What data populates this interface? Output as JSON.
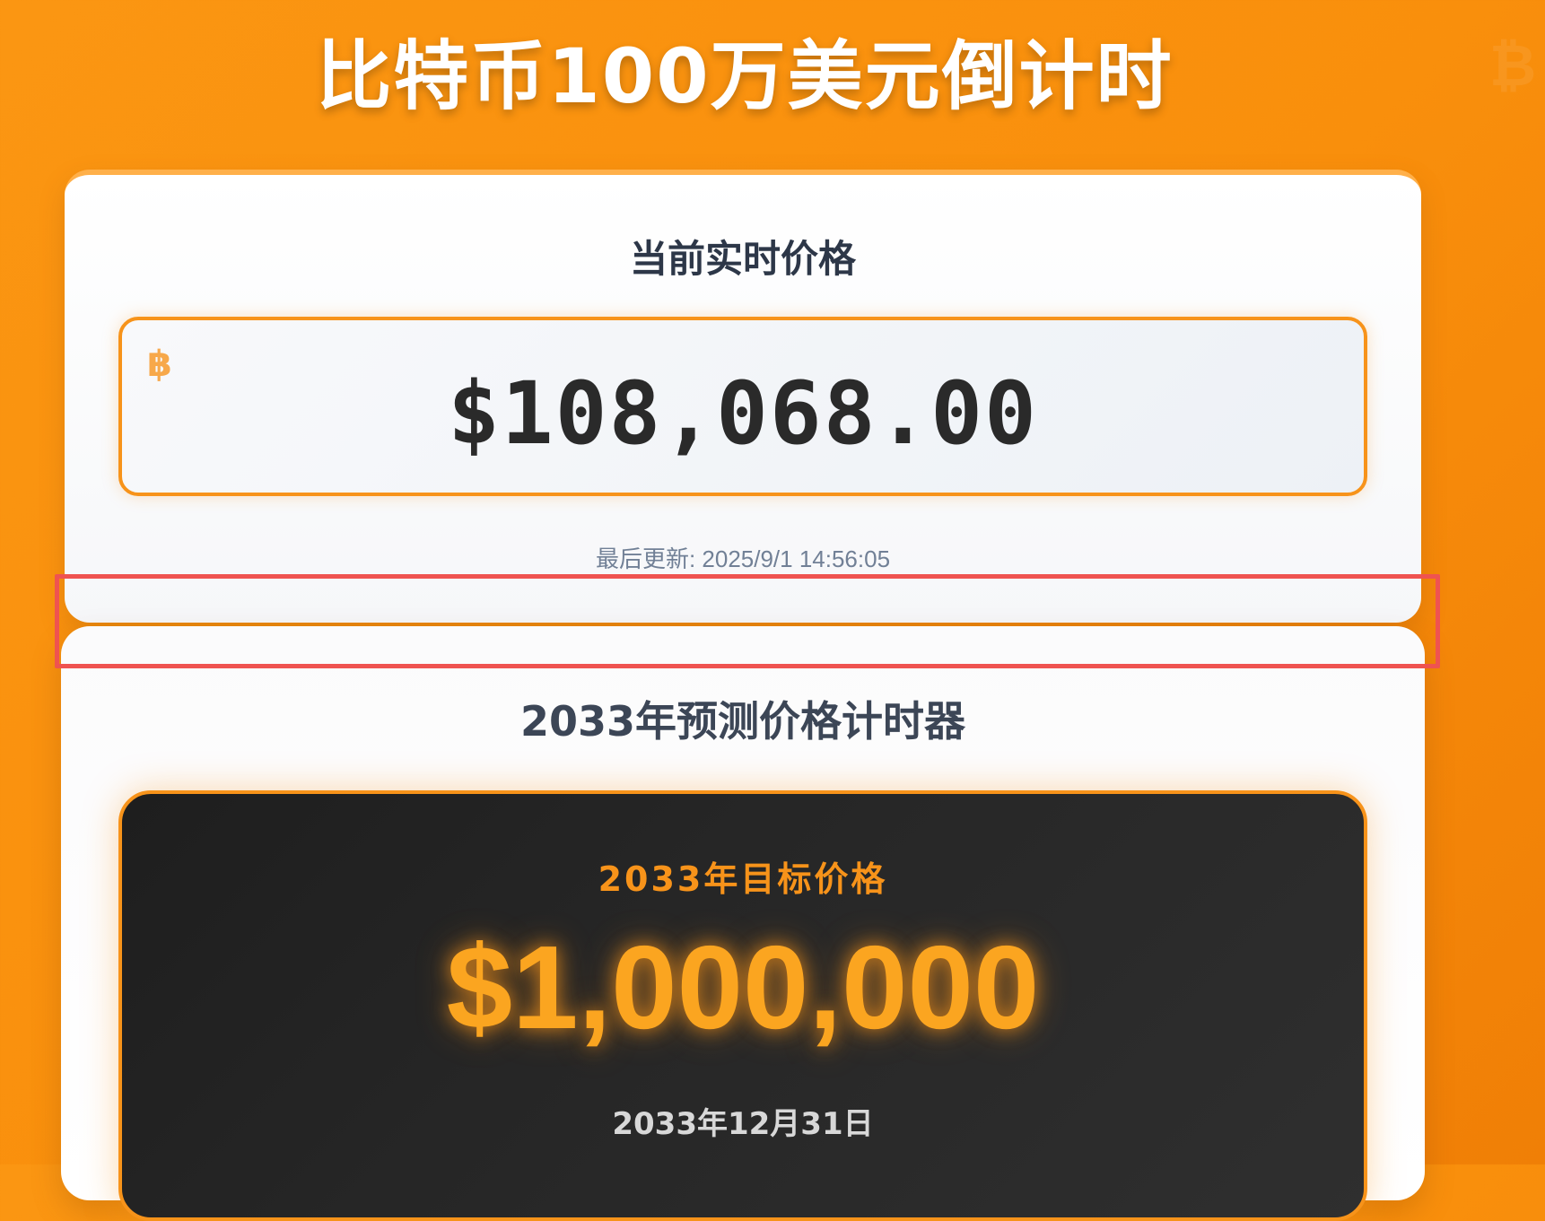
{
  "header": {
    "title": "比特币100万美元倒计时",
    "watermark_icon": "bitcoin-icon"
  },
  "current_price_card": {
    "title": "当前实时价格",
    "currency_icon": "bitcoin-icon",
    "currency_symbol": "฿",
    "price": "$108,068.00",
    "last_updated": "最后更新: 2025/9/1 14:56:05"
  },
  "prediction_card": {
    "title": "2033年预测价格计时器",
    "target_label": "2033年目标价格",
    "target_price": "$1,000,000",
    "target_date": "2033年12月31日"
  },
  "colors": {
    "accent": "#f7931a",
    "background": "#fb9612",
    "highlight": "#ef5350"
  }
}
